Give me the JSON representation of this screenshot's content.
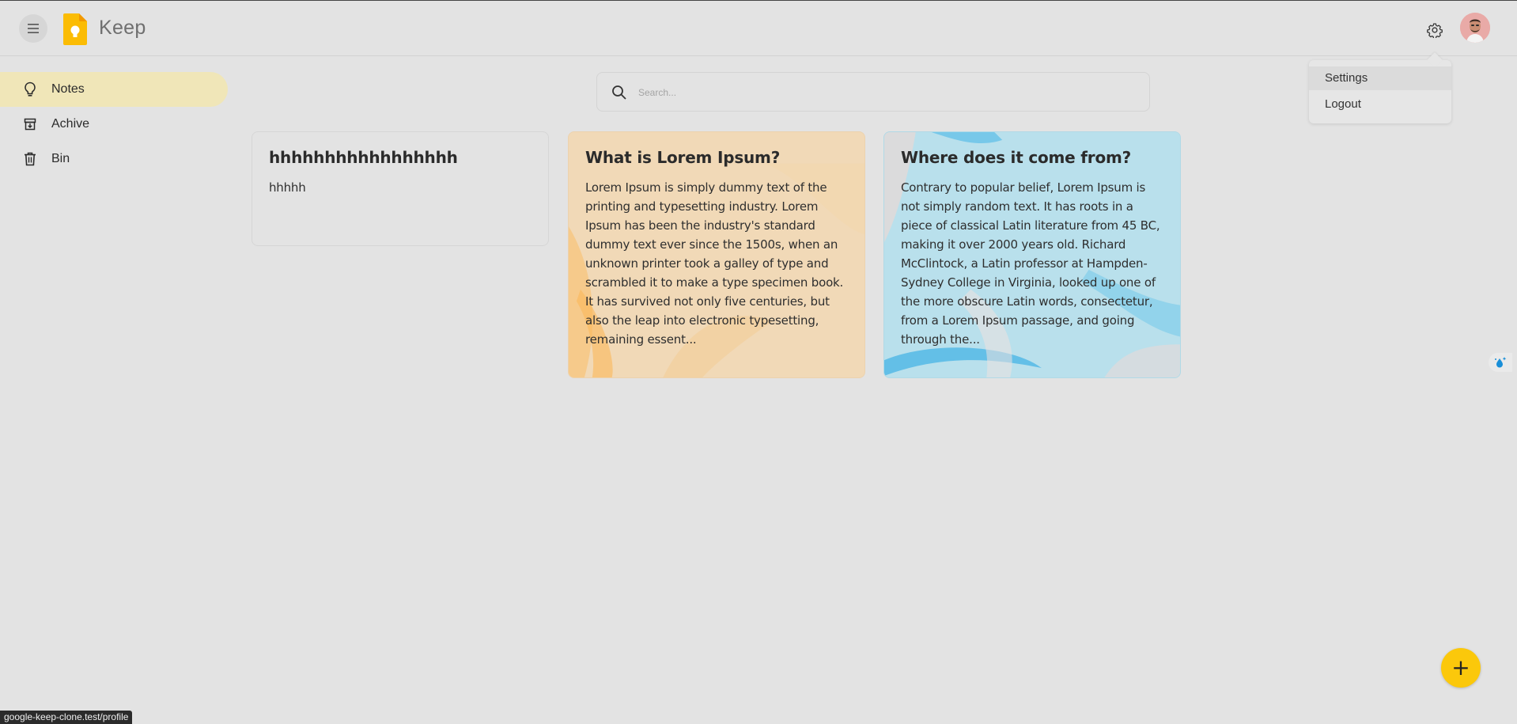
{
  "app": {
    "brand": "Keep",
    "accent_color": "#fbc80b"
  },
  "header": {
    "menu_icon": "hamburger-menu-icon",
    "settings_icon": "gear-icon"
  },
  "user_menu": {
    "items": [
      {
        "label": "Settings"
      },
      {
        "label": "Logout"
      }
    ]
  },
  "sidebar": {
    "items": [
      {
        "label": "Notes",
        "icon": "lightbulb-icon",
        "active": true
      },
      {
        "label": "Achive",
        "icon": "archive-icon",
        "active": false
      },
      {
        "label": "Bin",
        "icon": "trash-icon",
        "active": false
      }
    ]
  },
  "search": {
    "placeholder": "Search...",
    "value": ""
  },
  "notes": [
    {
      "title": "hhhhhhhhhhhhhhhhh",
      "body": "hhhhh",
      "background": "none"
    },
    {
      "title": "What is Lorem Ipsum?",
      "body": "Lorem Ipsum is simply dummy text of the printing and typesetting industry. Lorem Ipsum has been the industry's standard dummy text ever since the 1500s, when an unknown printer took a galley of type and scrambled it to make a type specimen book. It has survived not only five centuries, but also the leap into electronic typesetting, remaining essent...",
      "background": "#f1d9b7"
    },
    {
      "title": "Where does it come from?",
      "body": "Contrary to popular belief, Lorem Ipsum is not simply random text. It has roots in a piece of classical Latin literature from 45 BC, making it over 2000 years old. Richard McClintock, a Latin professor at Hampden-Sydney College in Virginia, looked up one of the more obscure Latin words, consectetur, from a Lorem Ipsum passage, and going through the...",
      "background": "#b9e0ec"
    }
  ],
  "fab": {
    "label": "+"
  },
  "statusbar": {
    "url": "google-keep-clone.test/profile"
  }
}
